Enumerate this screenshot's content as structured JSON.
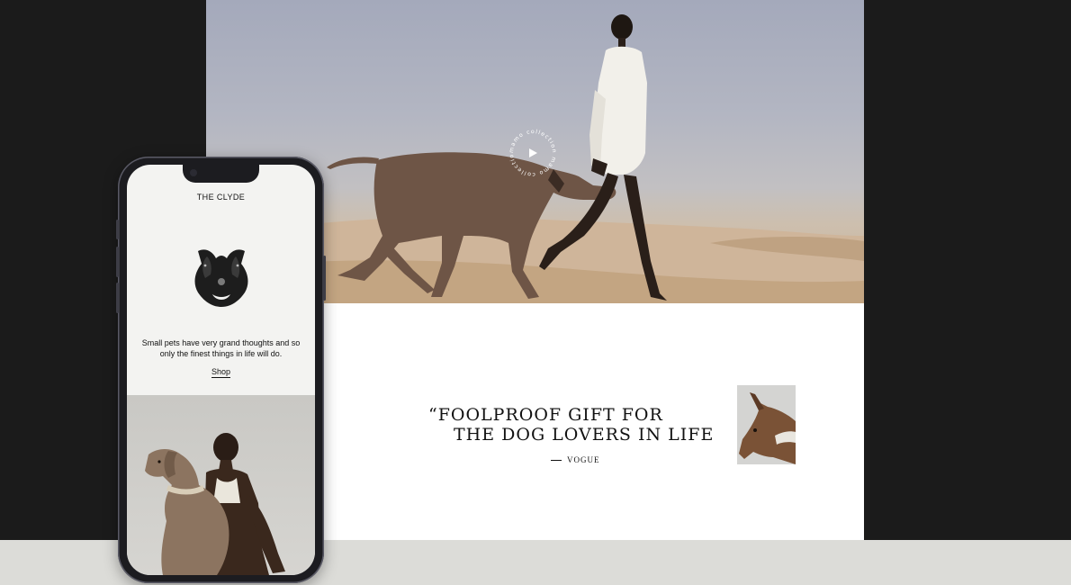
{
  "desktop": {
    "hero": {
      "image_alt": "Woman in white shirt walking a Weimaraner dog across sand dunes",
      "video_badge_text": "mamo collection mamo collection"
    },
    "quote": {
      "line1": "“FOOLPROOF GIFT FOR",
      "line2": "THE DOG LOVERS IN LIFE",
      "source": "VOGUE"
    }
  },
  "phone": {
    "product_title": "THE CLYDE",
    "description": "Small pets have very grand thoughts and so only the finest things in life will do.",
    "shop_label": "Shop"
  },
  "colors": {
    "background": "#1b1b1b",
    "floor": "#dcdcd8",
    "page": "#ffffff",
    "text": "#111111"
  }
}
